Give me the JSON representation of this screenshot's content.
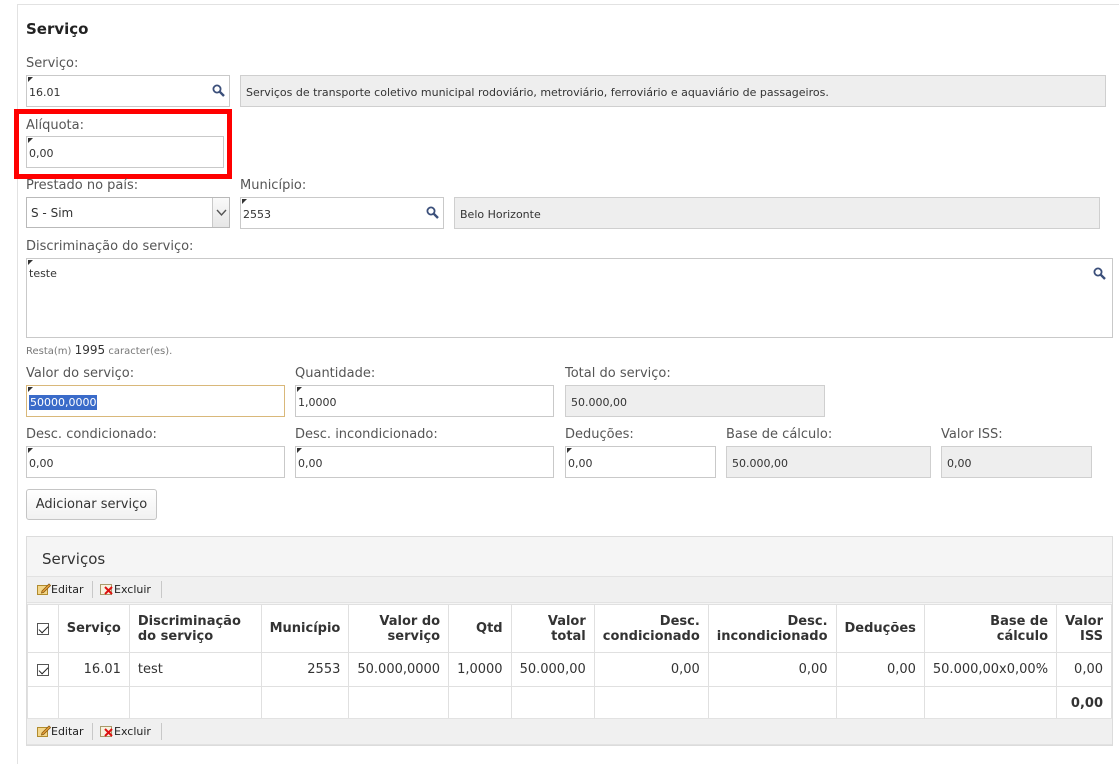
{
  "section_title": "Serviço",
  "servico": {
    "label": "Serviço:",
    "code": "16.01",
    "description": "Serviços de transporte coletivo municipal rodoviário, metroviário, ferroviário e aquaviário de passageiros."
  },
  "aliquota": {
    "label": "Alíquota:",
    "value": "0,00"
  },
  "prestado": {
    "label": "Prestado no país:",
    "value": "S - Sim"
  },
  "municipio": {
    "label": "Município:",
    "code": "2553",
    "name": "Belo Horizonte"
  },
  "discriminacao": {
    "label": "Discriminação do serviço:",
    "value": "teste",
    "remaining_prefix": "Resta(m)",
    "remaining_count": "1995",
    "remaining_suffix": "caracter(es)."
  },
  "valor_servico": {
    "label": "Valor do serviço:",
    "value": "50000,0000"
  },
  "quantidade": {
    "label": "Quantidade:",
    "value": "1,0000"
  },
  "total_servico": {
    "label": "Total do serviço:",
    "value": "50.000,00"
  },
  "desc_condicionado": {
    "label": "Desc. condicionado:",
    "value": "0,00"
  },
  "desc_incondicionado": {
    "label": "Desc. incondicionado:",
    "value": "0,00"
  },
  "deducoes": {
    "label": "Deduções:",
    "value": "0,00"
  },
  "base_calculo": {
    "label": "Base de cálculo:",
    "value": "50.000,00"
  },
  "valor_iss": {
    "label": "Valor ISS:",
    "value": "0,00"
  },
  "add_button": "Adicionar serviço",
  "grid": {
    "title": "Serviços",
    "toolbar": {
      "edit": "Editar",
      "delete": "Excluir"
    },
    "columns": {
      "servico": "Serviço",
      "discriminacao": "Discriminação do serviço",
      "municipio": "Município",
      "valor_l1": "Valor do",
      "valor_l2": "serviço",
      "qtd": "Qtd",
      "total_l1": "Valor",
      "total_l2": "total",
      "dcond_l1": "Desc.",
      "dcond_l2": "condicionado",
      "dinc_l1": "Desc.",
      "dinc_l2": "incondicionado",
      "deducoes": "Deduções",
      "base_l1": "Base de",
      "base_l2": "cálculo",
      "iss_l1": "Valor",
      "iss_l2": "ISS"
    },
    "row": {
      "servico": "16.01",
      "discriminacao": "test",
      "municipio": "2553",
      "valor": "50.000,0000",
      "qtd": "1,0000",
      "total": "50.000,00",
      "desc_cond": "0,00",
      "desc_inc": "0,00",
      "deducoes": "0,00",
      "base": "50.000,00x0,00%",
      "iss": "0,00"
    },
    "total_iss": "0,00"
  },
  "colors": {
    "highlight": "#ff0000",
    "selection": "#3a6bc9"
  }
}
